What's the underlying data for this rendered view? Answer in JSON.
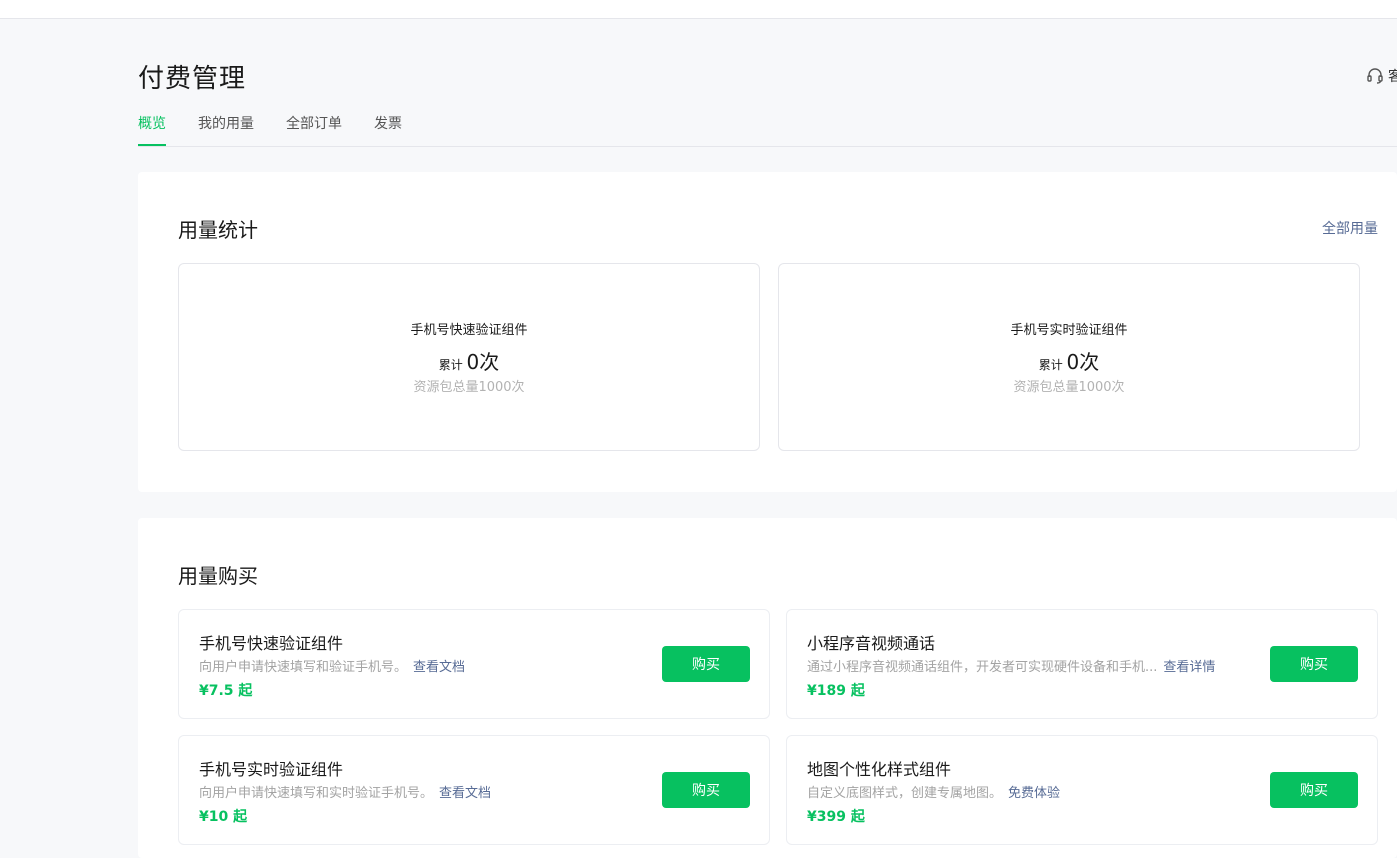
{
  "page": {
    "title": "付费管理",
    "support_label": "客服"
  },
  "tabs": [
    {
      "label": "概览",
      "active": true
    },
    {
      "label": "我的用量",
      "active": false
    },
    {
      "label": "全部订单",
      "active": false
    },
    {
      "label": "发票",
      "active": false
    }
  ],
  "usage_stats": {
    "title": "用量统计",
    "all_usage_link": "全部用量",
    "cards": [
      {
        "name": "手机号快速验证组件",
        "total_prefix": "累计",
        "total_value": "0次",
        "quota": "资源包总量1000次"
      },
      {
        "name": "手机号实时验证组件",
        "total_prefix": "累计",
        "total_value": "0次",
        "quota": "资源包总量1000次"
      }
    ]
  },
  "usage_purchase": {
    "title": "用量购买",
    "buy_label": "购买",
    "products": [
      {
        "name": "手机号快速验证组件",
        "desc": "向用户申请快速填写和验证手机号。",
        "link": "查看文档",
        "price": "¥7.5 起"
      },
      {
        "name": "小程序音视频通话",
        "desc": "通过小程序音视频通话组件，开发者可实现硬件设备和手机...",
        "link": "查看详情",
        "price": "¥189 起"
      },
      {
        "name": "手机号实时验证组件",
        "desc": "向用户申请快速填写和实时验证手机号。",
        "link": "查看文档",
        "price": "¥10 起"
      },
      {
        "name": "地图个性化样式组件",
        "desc": "自定义底图样式，创建专属地图。",
        "link": "免费体验",
        "price": "¥399 起"
      }
    ]
  },
  "colors": {
    "accent": "#07c160",
    "link": "#576b95",
    "muted": "#b2b2b2",
    "background": "#f7f8fa"
  },
  "icons": {
    "support": "headset-icon"
  }
}
